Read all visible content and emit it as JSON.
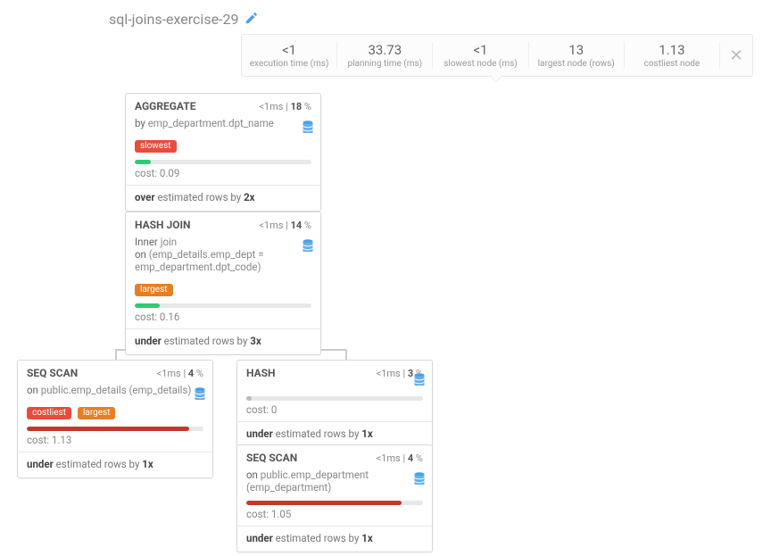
{
  "title": "sql-joins-exercise-29",
  "stats": {
    "exec_val": "<1",
    "exec_lbl": "execution time (ms)",
    "plan_val": "33.73",
    "plan_lbl": "planning time (ms)",
    "slow_val": "<1",
    "slow_lbl": "slowest node (ms)",
    "large_val": "13",
    "large_lbl": "largest node (rows)",
    "cost_val": "1.13",
    "cost_lbl": "costliest node"
  },
  "nodes": {
    "aggregate": {
      "name": "AGGREGATE",
      "time": "<1",
      "pct": "18",
      "by_kw": "by",
      "by_val": "emp_department.dpt_name",
      "tag": "slowest",
      "cost_lbl": "cost:",
      "cost": "0.09",
      "foot_b1": "over",
      "foot_mid": "estimated rows by",
      "foot_b2": "2x"
    },
    "hashjoin": {
      "name": "HASH JOIN",
      "time": "<1",
      "pct": "14",
      "l1a": "Inner",
      "l1b": "join",
      "l2a": "on",
      "l2b": "(emp_details.emp_dept = emp_department.dpt_code)",
      "tag": "largest",
      "cost_lbl": "cost:",
      "cost": "0.16",
      "foot_b1": "under",
      "foot_mid": "estimated rows by",
      "foot_b2": "3x"
    },
    "seq1": {
      "name": "SEQ SCAN",
      "time": "<1",
      "pct": "4",
      "on_kw": "on",
      "on_val": "public.emp_details (emp_details)",
      "tag1": "costliest",
      "tag2": "largest",
      "cost_lbl": "cost:",
      "cost": "1.13",
      "foot_b1": "under",
      "foot_mid": "estimated rows by",
      "foot_b2": "1x"
    },
    "hash": {
      "name": "HASH",
      "time": "<1",
      "pct": "3",
      "cost_lbl": "cost:",
      "cost": "0",
      "foot_b1": "under",
      "foot_mid": "estimated rows by",
      "foot_b2": "1x"
    },
    "seq2": {
      "name": "SEQ SCAN",
      "time": "<1",
      "pct": "4",
      "on_kw": "on",
      "on_val": "public.emp_department (emp_department)",
      "cost_lbl": "cost:",
      "cost": "1.05",
      "foot_b1": "under",
      "foot_mid": "estimated rows by",
      "foot_b2": "1x"
    }
  }
}
